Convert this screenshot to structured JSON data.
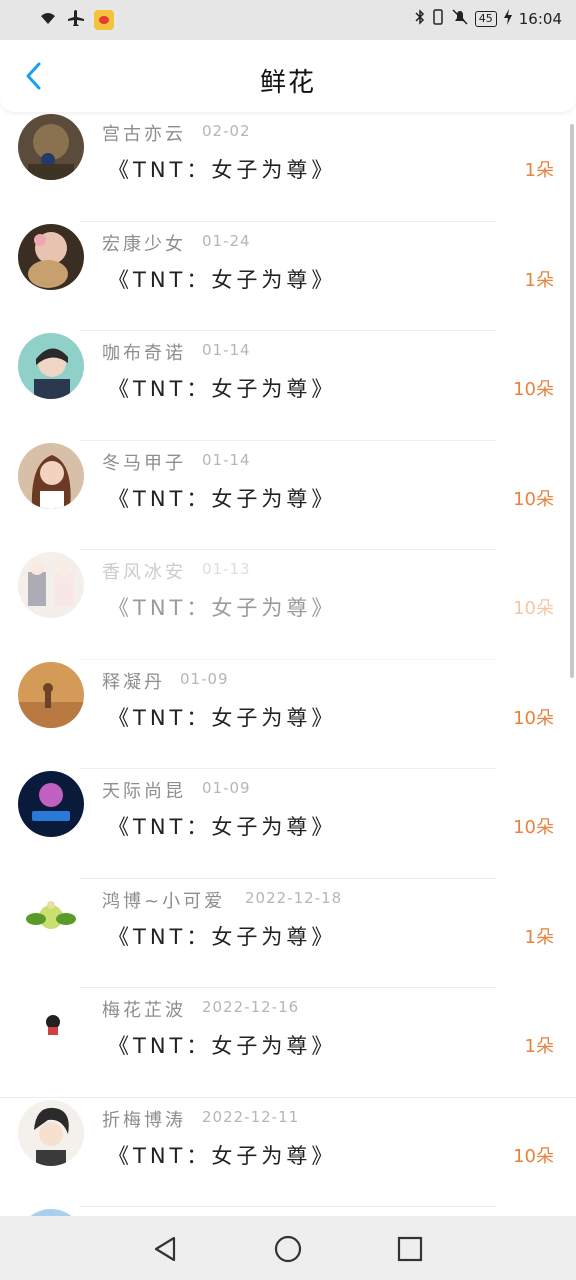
{
  "status_bar": {
    "time": "16:04",
    "battery": "45"
  },
  "header": {
    "title": "鲜花"
  },
  "items": [
    {
      "nickname": "宫古亦云",
      "date": "02-02",
      "work": "《TNT：女子为尊》",
      "amount": "1朵"
    },
    {
      "nickname": "宏康少女",
      "date": "01-24",
      "work": "《TNT：女子为尊》",
      "amount": "1朵"
    },
    {
      "nickname": "咖布奇诺",
      "date": "01-14",
      "work": "《TNT：女子为尊》",
      "amount": "10朵"
    },
    {
      "nickname": "冬马甲子",
      "date": "01-14",
      "work": "《TNT：女子为尊》",
      "amount": "10朵"
    },
    {
      "nickname": "香风冰安",
      "date": "01-13",
      "work": "《TNT：女子为尊》",
      "amount": "10朵"
    },
    {
      "nickname": "释凝丹",
      "date": "01-09",
      "work": "《TNT：女子为尊》",
      "amount": "10朵"
    },
    {
      "nickname": "天际尚昆",
      "date": "01-09",
      "work": "《TNT：女子为尊》",
      "amount": "10朵"
    },
    {
      "nickname": "鸿博~小可爱",
      "date": "2022-12-18",
      "work": "《TNT：女子为尊》",
      "amount": "1朵"
    },
    {
      "nickname": "梅花芷波",
      "date": "2022-12-16",
      "work": "《TNT：女子为尊》",
      "amount": "1朵"
    },
    {
      "nickname": "折梅博涛",
      "date": "2022-12-11",
      "work": "《TNT：女子为尊》",
      "amount": "10朵"
    }
  ]
}
